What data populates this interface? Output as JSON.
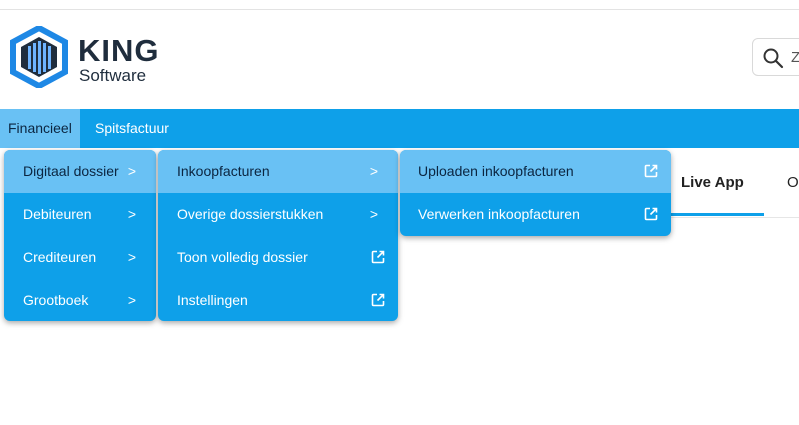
{
  "brand": {
    "name": "KING",
    "sub": "Software"
  },
  "search": {
    "visible_text": "Z"
  },
  "nav": {
    "items": [
      "Financieel",
      "Spitsfactuur"
    ]
  },
  "tabs": {
    "active": "Live App",
    "next": "O"
  },
  "menu1": {
    "items": [
      {
        "label": "Digitaal dossier",
        "icon": "chevron-right"
      },
      {
        "label": "Debiteuren",
        "icon": "chevron-right"
      },
      {
        "label": "Crediteuren",
        "icon": "chevron-right"
      },
      {
        "label": "Grootboek",
        "icon": "chevron-right"
      }
    ]
  },
  "menu2": {
    "items": [
      {
        "label": "Inkoopfacturen",
        "icon": "chevron-right"
      },
      {
        "label": "Overige dossierstukken",
        "icon": "chevron-right"
      },
      {
        "label": "Toon volledig dossier",
        "icon": "external-link"
      },
      {
        "label": "Instellingen",
        "icon": "external-link"
      }
    ]
  },
  "menu3": {
    "items": [
      {
        "label": "Uploaden inkoopfacturen",
        "icon": "external-link"
      },
      {
        "label": "Verwerken inkoopfacturen",
        "icon": "external-link"
      }
    ]
  },
  "chevron_glyph": ">",
  "colors": {
    "nav_bg": "#0ea0e9",
    "highlight": "#69c1f4",
    "brand_dark": "#1f2d3d"
  }
}
